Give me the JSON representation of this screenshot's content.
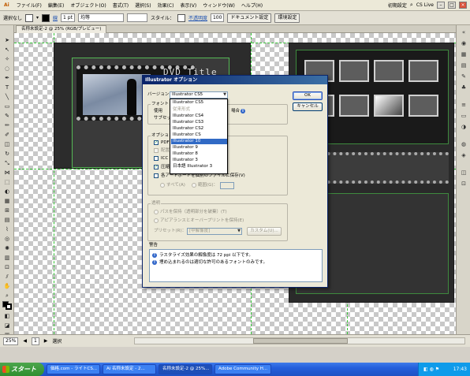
{
  "menu": {
    "items": [
      "ファイル(F)",
      "編集(E)",
      "オブジェクト(O)",
      "書式(T)",
      "選択(S)",
      "効果(C)",
      "表示(V)",
      "ウィンドウ(W)",
      "ヘルプ(H)"
    ],
    "workspace": "初期設定",
    "cslive": "CS Live"
  },
  "control_bar": {
    "selection_label": "選択なし",
    "stroke_label": "線",
    "stroke_weight": "1 pt",
    "stroke_style": "均等",
    "style_label": "スタイル：",
    "opacity_label": "不透明度",
    "opacity_value": "100",
    "doc_setup_button": "ドキュメント設定",
    "prefs_button": "環境設定"
  },
  "document": {
    "tab_label": "名称未設定-2 @ 25% (RGB/プレビュー)"
  },
  "artwork": {
    "dvd_title": "DVD Title"
  },
  "dialog": {
    "title": "Illustrator オプション",
    "version_label": "バージョン：",
    "version_value": "Illustrator CS5",
    "ok_button": "OK",
    "cancel_button": "キャンセル",
    "font_section": "フォント",
    "font_subset_label": "使用",
    "font_subset_suffix": "場合",
    "subset_hint": "サブセット",
    "options_section": "オプション",
    "opt_pdf": "PDF",
    "opt_link": "配置",
    "opt_icc": "ICC",
    "opt_compress": "圧縮",
    "opt_artboards": "各アートボードを個別のファイルに保存(V)",
    "range_all": "すべて(A)",
    "range_label": "範囲(G)：",
    "transparency_section": "透明",
    "transp_keep_paths": "パスを保持（透明部分を破棄）(T)",
    "transp_keep_appearance": "アピアランスとオーバープリントを保持(E)",
    "preset_label": "プリセット(R)：",
    "preset_value": "[中解像度]",
    "custom_button": "カスタム(U)...",
    "warnings_label": "警告",
    "warning_1": "ラスタライズ効果の解像度は 72 ppi 以下です。",
    "warning_2": "埋め込まれるのは適切な許可のあるフォントのみです。",
    "dropdown": {
      "items": [
        "Illustrator CS5",
        "従来形式",
        "Illustrator CS4",
        "Illustrator CS3",
        "Illustrator CS2",
        "Illustrator CS",
        "Illustrator 10",
        "Illustrator 9",
        "Illustrator 8",
        "Illustrator 3",
        "日本語 Illustrator 3"
      ],
      "selected": "Illustrator 10"
    }
  },
  "status_bar": {
    "zoom": "25%",
    "artboard_number": "1",
    "tool_label": "選択"
  },
  "taskbar": {
    "start_label": "スタート",
    "tasks": [
      "価格.com - ライトCS...",
      "Ai 名称未設定 - 2...",
      "名称未設定-2 @ 25%...",
      "Adobe Community H..."
    ],
    "active_task": "名称未設定-2 @ 25%...",
    "time": "17:43"
  },
  "colors": {
    "selection_highlight": "#316ac5",
    "guide_green": "#34c434",
    "titlebar_dark": "#0a246a"
  }
}
